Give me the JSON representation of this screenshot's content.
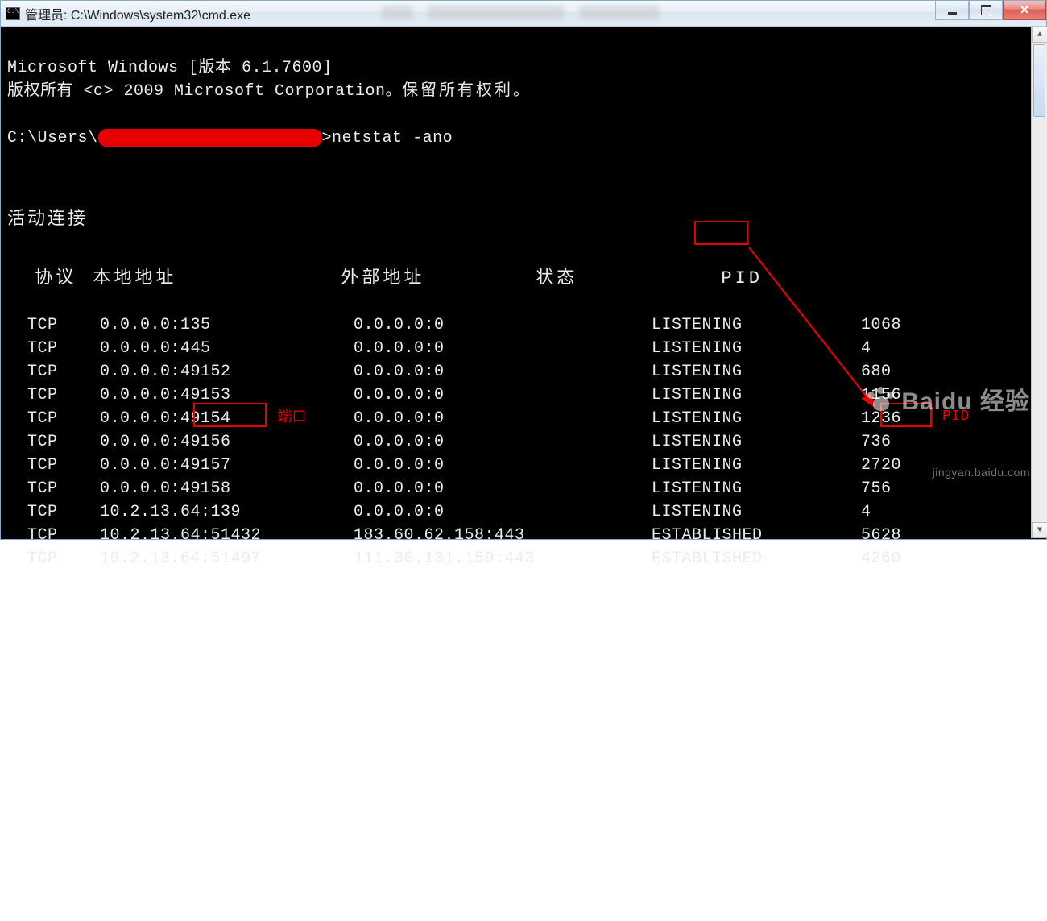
{
  "window": {
    "title": "管理员: C:\\Windows\\system32\\cmd.exe"
  },
  "banner": {
    "line1": "Microsoft Windows [版本 6.1.7600]",
    "line2_a": "版权所有 <c> 2009 Microsoft Corporation。",
    "line2_b": "保留所有权利。"
  },
  "prompt": {
    "prefix": "C:\\Users\\",
    "command": "netstat -ano"
  },
  "section_title": "活动连接",
  "headers": {
    "proto": "协议",
    "local": "本地地址",
    "foreign": "外部地址",
    "state": "状态",
    "pid": "PID"
  },
  "rows": [
    {
      "proto": "TCP",
      "local": "0.0.0.0:135",
      "foreign": "0.0.0.0:0",
      "state": "LISTENING",
      "pid": "1068"
    },
    {
      "proto": "TCP",
      "local": "0.0.0.0:445",
      "foreign": "0.0.0.0:0",
      "state": "LISTENING",
      "pid": "4"
    },
    {
      "proto": "TCP",
      "local": "0.0.0.0:49152",
      "foreign": "0.0.0.0:0",
      "state": "LISTENING",
      "pid": "680"
    },
    {
      "proto": "TCP",
      "local": "0.0.0.0:49153",
      "foreign": "0.0.0.0:0",
      "state": "LISTENING",
      "pid": "1156"
    },
    {
      "proto": "TCP",
      "local": "0.0.0.0:49154",
      "foreign": "0.0.0.0:0",
      "state": "LISTENING",
      "pid": "1236"
    },
    {
      "proto": "TCP",
      "local": "0.0.0.0:49156",
      "foreign": "0.0.0.0:0",
      "state": "LISTENING",
      "pid": "736"
    },
    {
      "proto": "TCP",
      "local": "0.0.0.0:49157",
      "foreign": "0.0.0.0:0",
      "state": "LISTENING",
      "pid": "2720"
    },
    {
      "proto": "TCP",
      "local": "0.0.0.0:49158",
      "foreign": "0.0.0.0:0",
      "state": "LISTENING",
      "pid": "756"
    },
    {
      "proto": "TCP",
      "local": "10.2.13.64:139",
      "foreign": "0.0.0.0:0",
      "state": "LISTENING",
      "pid": "4"
    },
    {
      "proto": "TCP",
      "local": "10.2.13.64:51432",
      "foreign": "183.60.62.158:443",
      "state": "ESTABLISHED",
      "pid": "5628"
    },
    {
      "proto": "TCP",
      "local": "10.2.13.64:51497",
      "foreign": "111.30.131.159:443",
      "state": "ESTABLISHED",
      "pid": "4260"
    }
  ],
  "annotations": {
    "port_label": "端口",
    "pid_label": "PID"
  },
  "watermark": {
    "brand": "Baidu 经验",
    "url": "jingyan.baidu.com"
  }
}
